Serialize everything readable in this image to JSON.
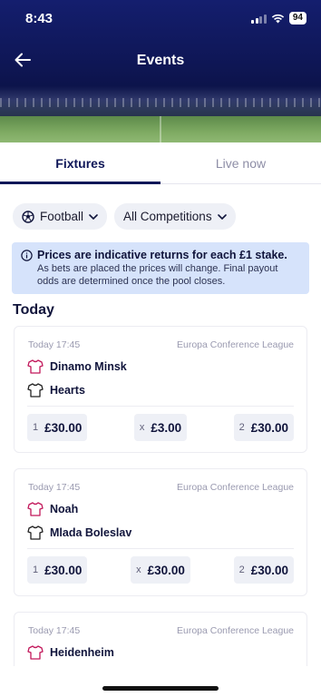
{
  "status_bar": {
    "time": "8:43",
    "battery": "94"
  },
  "header": {
    "title": "Events"
  },
  "tabs": [
    {
      "label": "Fixtures",
      "active": true
    },
    {
      "label": "Live now",
      "active": false
    }
  ],
  "filters": {
    "sport": "Football",
    "competition": "All Competitions"
  },
  "notice": {
    "title": "Prices are indicative returns for each £1 stake.",
    "body": "As bets are placed the prices will change. Final payout odds are determined once the pool closes."
  },
  "section_title": "Today",
  "events": [
    {
      "time": "Today 17:45",
      "competition": "Europa Conference League",
      "home_team": "Dinamo Minsk",
      "away_team": "Hearts",
      "odds": [
        {
          "key": "1",
          "price": "£30.00"
        },
        {
          "key": "x",
          "price": "£3.00"
        },
        {
          "key": "2",
          "price": "£30.00"
        }
      ]
    },
    {
      "time": "Today 17:45",
      "competition": "Europa Conference League",
      "home_team": "Noah",
      "away_team": "Mlada Boleslav",
      "odds": [
        {
          "key": "1",
          "price": "£30.00"
        },
        {
          "key": "x",
          "price": "£30.00"
        },
        {
          "key": "2",
          "price": "£30.00"
        }
      ]
    },
    {
      "time": "Today 17:45",
      "competition": "Europa Conference League",
      "home_team": "Heidenheim"
    }
  ],
  "colors": {
    "brand_navy": "#0f1758",
    "home_shirt": "#c2185b",
    "away_shirt": "#222222",
    "notice_bg": "#d6e3fb"
  },
  "icons": {
    "back": "arrow-left-icon",
    "sport": "football-icon",
    "dropdown": "chevron-down-icon",
    "info": "info-icon",
    "home_kit": "shirt-icon",
    "away_kit": "shirt-icon"
  }
}
